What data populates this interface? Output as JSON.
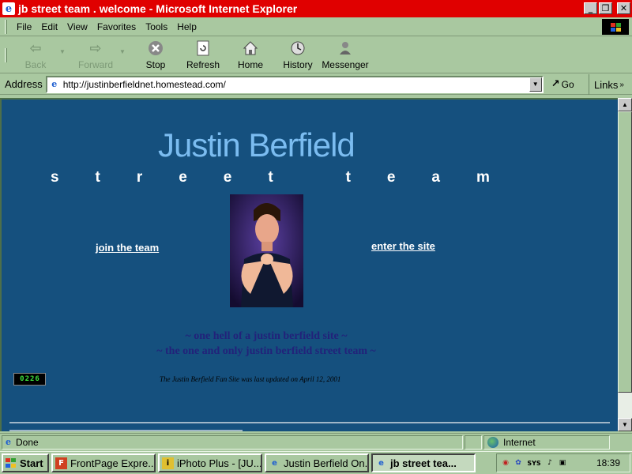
{
  "window": {
    "title": "jb street team . welcome - Microsoft Internet Explorer"
  },
  "menubar": {
    "items": [
      {
        "label": "File"
      },
      {
        "label": "Edit"
      },
      {
        "label": "View"
      },
      {
        "label": "Favorites"
      },
      {
        "label": "Tools"
      },
      {
        "label": "Help"
      }
    ]
  },
  "toolbar": {
    "back_label": "Back",
    "forward_label": "Forward",
    "stop_label": "Stop",
    "refresh_label": "Refresh",
    "home_label": "Home",
    "history_label": "History",
    "messenger_label": "Messenger"
  },
  "addressbar": {
    "label": "Address",
    "url": "http://justinberfieldnet.homestead.com/",
    "go_label": "Go",
    "links_label": "Links"
  },
  "page": {
    "title": "Justin Berfield",
    "subtitle_letters": [
      "s",
      "t",
      "r",
      "e",
      "e",
      "t",
      "",
      "t",
      "e",
      "a",
      "m"
    ],
    "join_link": "join the team",
    "enter_link": "enter the site",
    "tagline_1": "~ one hell of a justin berfield site ~",
    "tagline_2": "~ the one and only justin berfield street team ~",
    "counter_digits": [
      "0",
      "2",
      "2",
      "6"
    ],
    "updated_text": "The Justin Berfield Fan Site was last updated on April 12, 2001"
  },
  "statusbar": {
    "status_text": "Done",
    "zone_text": "Internet"
  },
  "taskbar": {
    "start_label": "Start",
    "tasks": [
      {
        "label": "FrontPage Expre...",
        "active": false
      },
      {
        "label": "iPhoto Plus - [JU...",
        "active": false
      },
      {
        "label": "Justin Berfield On...",
        "active": false
      },
      {
        "label": "jb street tea...",
        "active": true
      }
    ],
    "tray_text": "SYS",
    "clock": "18:39"
  },
  "colors": {
    "page_background": "#15507e",
    "title_color": "#7bbcf0",
    "tagline_color": "#22227a",
    "titlebar": "#e00000",
    "chrome": "#a9c8a0"
  }
}
